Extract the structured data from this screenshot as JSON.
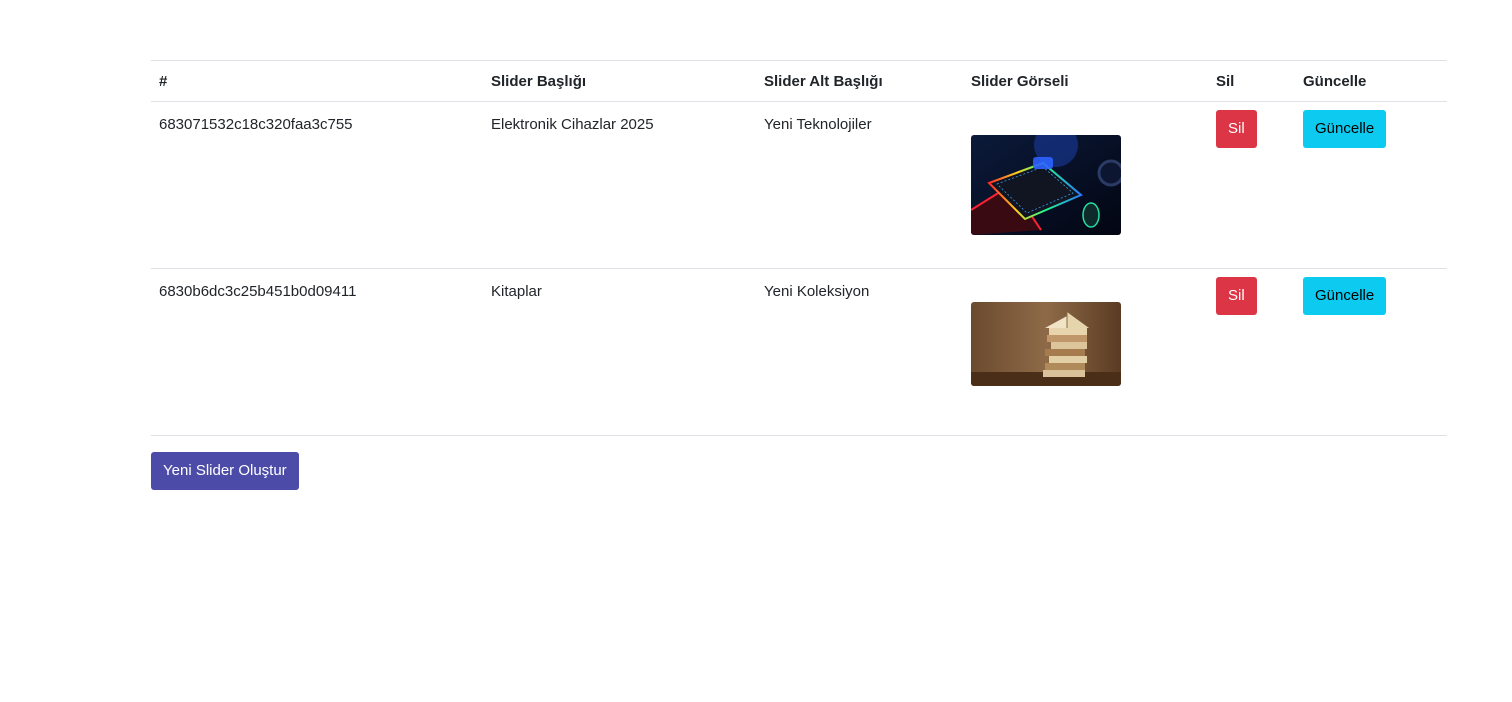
{
  "table": {
    "headers": {
      "id": "#",
      "title": "Slider Başlığı",
      "subtitle": "Slider Alt Başlığı",
      "image": "Slider Görseli",
      "delete": "Sil",
      "update": "Güncelle"
    },
    "rows": [
      {
        "id": "683071532c18c320faa3c755",
        "title": "Elektronik Cihazlar 2025",
        "subtitle": "Yeni Teknolojiler",
        "image_icon": "gaming-keyboard-photo",
        "delete_label": "Sil",
        "update_label": "Güncelle"
      },
      {
        "id": "6830b6dc3c25b451b0d09411",
        "title": "Kitaplar",
        "subtitle": "Yeni Koleksiyon",
        "image_icon": "book-stack-photo",
        "delete_label": "Sil",
        "update_label": "Güncelle"
      }
    ]
  },
  "create_button_label": "Yeni Slider Oluştur",
  "colors": {
    "danger": "#dc3545",
    "info": "#0dcaf0",
    "primary": "#4c4ba8",
    "border": "#dee2e6"
  }
}
